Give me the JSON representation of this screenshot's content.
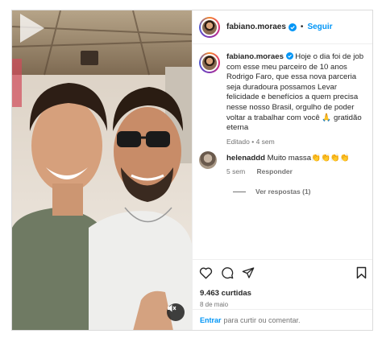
{
  "post": {
    "username": "fabiano.moraes",
    "follow_label": "Seguir",
    "dot": "•",
    "caption": "Hoje o dia foi de job com esse meu parceiro de 10 anos Rodrigo Faro, que essa nova parceria seja duradoura possamos Levar felicidade e benefícios a quem precisa nesse nosso Brasil, orgulho de poder voltar a trabalhar com você 🙏 gratidão eterna",
    "edited": "Editado",
    "time": "4 sem",
    "likes": "9.463 curtidas",
    "date": "8 de maio"
  },
  "comment": {
    "username": "helenaddd",
    "text": "Muito massa👏👏👏👏",
    "time": "5 sem",
    "reply_label": "Responder",
    "view_replies": "Ver respostas (1)"
  },
  "login_prompt": {
    "login": "Entrar",
    "rest": "para curtir ou comentar."
  },
  "icons": [
    "verified-badge-icon",
    "more-options-icon",
    "heart-icon",
    "comment-icon",
    "share-icon",
    "bookmark-icon",
    "play-icon",
    "sound-muted-icon"
  ],
  "colors": {
    "accent": "#0095f6",
    "text": "#262626",
    "muted": "#737373",
    "border": "#dbdbdb"
  }
}
